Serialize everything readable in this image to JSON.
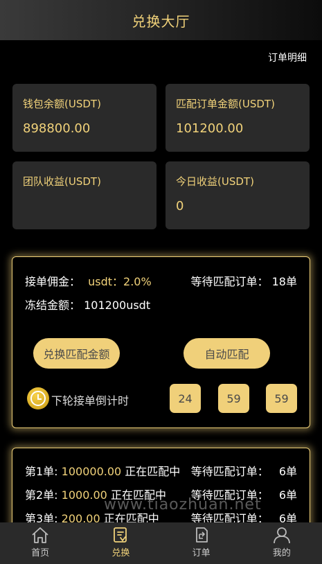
{
  "header": {
    "title": "兑换大厅"
  },
  "order_detail_link": "订单明细",
  "stats": [
    {
      "label": "钱包余额(USDT)",
      "value": "898800.00"
    },
    {
      "label": "匹配订单金额(USDT)",
      "value": "101200.00"
    },
    {
      "label": "团队收益(USDT)",
      "value": ""
    },
    {
      "label": "今日收益(USDT)",
      "value": "0"
    }
  ],
  "commission": {
    "label": "接单佣金：",
    "value": "usdt：2.0%"
  },
  "waiting": {
    "label": "等待匹配订单：",
    "value": "18单"
  },
  "frozen": {
    "label": "冻结金额：",
    "value": "101200usdt"
  },
  "buttons": {
    "exchange": "兑换匹配金额",
    "auto": "自动匹配"
  },
  "countdown": {
    "label": "下轮接单倒计时",
    "values": [
      "24",
      "59",
      "59"
    ]
  },
  "orders": [
    {
      "name": "第1单:",
      "amount": "100000.00",
      "status": "正在匹配中",
      "waiting": "等待匹配订单：",
      "count": "6单"
    },
    {
      "name": "第2单:",
      "amount": "1000.00",
      "status": "正在匹配中",
      "waiting": "等待匹配订单：",
      "count": "6单"
    },
    {
      "name": "第3单:",
      "amount": "200.00",
      "status": "正在匹配中",
      "waiting": "等待匹配订单：",
      "count": "6单"
    }
  ],
  "watermark": "www.tiaozhuan.net",
  "tabs": [
    {
      "label": "首页",
      "icon": "home-icon"
    },
    {
      "label": "兑换",
      "icon": "exchange-icon"
    },
    {
      "label": "订单",
      "icon": "order-icon"
    },
    {
      "label": "我的",
      "icon": "user-icon"
    }
  ],
  "colors": {
    "accent": "#f1d27a",
    "card": "#2a2a2a",
    "background": "#000000"
  }
}
